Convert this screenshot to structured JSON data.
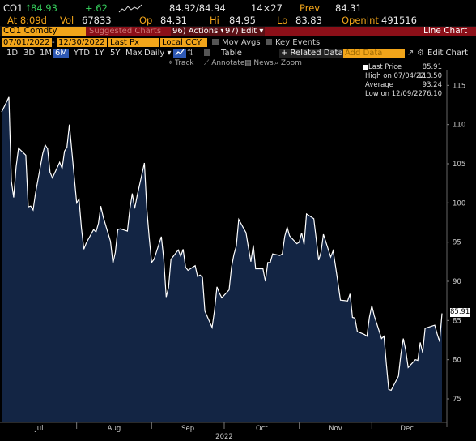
{
  "quote": {
    "ticker": "CO1",
    "arrow": "↑",
    "last": "84.93",
    "change": "+.62",
    "bid_ask": "84.92/84.94",
    "size": "14×27",
    "prev_label": "Prev",
    "prev": "84.31",
    "time": "At 8:09d",
    "vol_label": "Vol",
    "vol": "67833",
    "op_label": "Op",
    "op": "84.31",
    "hi_label": "Hi",
    "hi": "84.95",
    "lo_label": "Lo",
    "lo": "83.83",
    "openint_label": "OpenInt",
    "openint": "491516"
  },
  "toolbar": {
    "security": "CO1 Comdty",
    "suggested": "Suggested Charts",
    "actions": "96) Actions ▾",
    "edit": "97) Edit ▾",
    "title": "Line Chart",
    "start_date": "07/01/2022",
    "end_date": "12/30/2022",
    "field": "Last Px",
    "currency": "Local CCY",
    "mov_avgs": "Mov Avgs",
    "key_events": "Key Events",
    "ranges": [
      "1D",
      "3D",
      "1M",
      "6M",
      "YTD",
      "1Y",
      "5Y",
      "Max"
    ],
    "selected_range": "6M",
    "frequency": "Daily ▾",
    "table": "Table",
    "related_data": "+ Related Data ▾",
    "add_data": "Add Data",
    "edit_chart": "Edit Chart",
    "track": "Track",
    "annotate": "Annotate",
    "news": "News",
    "zoom": "Zoom"
  },
  "legend": {
    "items": [
      {
        "label": "Last Price",
        "value": "85.91"
      },
      {
        "label": "High on 07/04/22",
        "value": "113.50"
      },
      {
        "label": "Average",
        "value": "93.24"
      },
      {
        "label": "Low on 12/09/22",
        "value": "76.10"
      }
    ]
  },
  "colors": {
    "background": "#000000",
    "area_fill": "#132544",
    "line": "#ffffff",
    "accent": "#f2a51a",
    "up": "#34c759"
  },
  "chart_data": {
    "type": "area",
    "ylim": [
      72,
      117
    ],
    "yticks": [
      75,
      80,
      85,
      90,
      95,
      100,
      105,
      110,
      115
    ],
    "x_tick_labels": [
      "Jul",
      "Aug",
      "Sep",
      "Oct",
      "Nov",
      "Dec"
    ],
    "x_year_label": "2022",
    "last_value_label": "85.91",
    "x": [
      "2022-07-01",
      "2022-07-04",
      "2022-07-05",
      "2022-07-06",
      "2022-07-07",
      "2022-07-08",
      "2022-07-11",
      "2022-07-12",
      "2022-07-13",
      "2022-07-14",
      "2022-07-15",
      "2022-07-18",
      "2022-07-19",
      "2022-07-20",
      "2022-07-21",
      "2022-07-22",
      "2022-07-25",
      "2022-07-26",
      "2022-07-27",
      "2022-07-28",
      "2022-07-29",
      "2022-08-01",
      "2022-08-02",
      "2022-08-03",
      "2022-08-04",
      "2022-08-05",
      "2022-08-08",
      "2022-08-09",
      "2022-08-10",
      "2022-08-11",
      "2022-08-12",
      "2022-08-15",
      "2022-08-16",
      "2022-08-17",
      "2022-08-18",
      "2022-08-19",
      "2022-08-22",
      "2022-08-23",
      "2022-08-24",
      "2022-08-25",
      "2022-08-26",
      "2022-08-29",
      "2022-08-30",
      "2022-08-31",
      "2022-09-01",
      "2022-09-02",
      "2022-09-05",
      "2022-09-06",
      "2022-09-07",
      "2022-09-08",
      "2022-09-09",
      "2022-09-12",
      "2022-09-13",
      "2022-09-14",
      "2022-09-15",
      "2022-09-16",
      "2022-09-19",
      "2022-09-20",
      "2022-09-21",
      "2022-09-22",
      "2022-09-23",
      "2022-09-26",
      "2022-09-27",
      "2022-09-28",
      "2022-09-29",
      "2022-09-30",
      "2022-10-03",
      "2022-10-04",
      "2022-10-05",
      "2022-10-06",
      "2022-10-07",
      "2022-10-10",
      "2022-10-11",
      "2022-10-12",
      "2022-10-13",
      "2022-10-14",
      "2022-10-17",
      "2022-10-18",
      "2022-10-19",
      "2022-10-20",
      "2022-10-21",
      "2022-10-24",
      "2022-10-25",
      "2022-10-26",
      "2022-10-27",
      "2022-10-28",
      "2022-10-31",
      "2022-11-01",
      "2022-11-02",
      "2022-11-03",
      "2022-11-04",
      "2022-11-07",
      "2022-11-08",
      "2022-11-09",
      "2022-11-10",
      "2022-11-11",
      "2022-11-14",
      "2022-11-15",
      "2022-11-16",
      "2022-11-17",
      "2022-11-18",
      "2022-11-21",
      "2022-11-22",
      "2022-11-23",
      "2022-11-24",
      "2022-11-25",
      "2022-11-28",
      "2022-11-29",
      "2022-11-30",
      "2022-12-01",
      "2022-12-02",
      "2022-12-05",
      "2022-12-06",
      "2022-12-07",
      "2022-12-08",
      "2022-12-09",
      "2022-12-12",
      "2022-12-13",
      "2022-12-14",
      "2022-12-15",
      "2022-12-16",
      "2022-12-19",
      "2022-12-20",
      "2022-12-21",
      "2022-12-22",
      "2022-12-23",
      "2022-12-27",
      "2022-12-28",
      "2022-12-29",
      "2022-12-30"
    ],
    "values": [
      111.6,
      113.5,
      102.8,
      100.7,
      104.6,
      107.0,
      106.1,
      99.5,
      99.6,
      99.1,
      101.2,
      106.3,
      107.4,
      106.9,
      103.9,
      103.2,
      105.2,
      104.4,
      106.6,
      107.1,
      110.0,
      100.0,
      100.5,
      96.8,
      94.1,
      94.9,
      96.6,
      96.3,
      97.4,
      99.6,
      98.2,
      95.1,
      92.3,
      93.7,
      96.6,
      96.7,
      96.4,
      99.2,
      101.2,
      99.3,
      100.9,
      105.1,
      99.3,
      95.6,
      92.4,
      92.8,
      95.7,
      92.8,
      88.0,
      89.2,
      92.8,
      94.0,
      93.2,
      94.1,
      91.8,
      91.4,
      92.0,
      90.6,
      90.8,
      90.5,
      86.2,
      84.1,
      86.3,
      89.3,
      88.5,
      87.9,
      88.9,
      91.8,
      93.4,
      94.5,
      97.9,
      96.2,
      94.3,
      92.5,
      94.6,
      91.6,
      91.6,
      90.0,
      92.4,
      92.4,
      93.5,
      93.3,
      93.5,
      95.7,
      96.9,
      95.8,
      94.8,
      95.0,
      96.2,
      94.7,
      98.6,
      98.0,
      95.4,
      92.7,
      93.7,
      96.0,
      93.1,
      93.9,
      91.9,
      89.8,
      87.6,
      87.5,
      88.4,
      85.4,
      85.3,
      83.6,
      83.2,
      83.0,
      85.4,
      86.9,
      85.6,
      82.7,
      83.0,
      79.4,
      76.2,
      76.1,
      77.9,
      80.7,
      82.7,
      81.2,
      79.0,
      80.0,
      79.9,
      82.2,
      80.9,
      84.0,
      84.4,
      83.3,
      82.3,
      85.9
    ]
  }
}
